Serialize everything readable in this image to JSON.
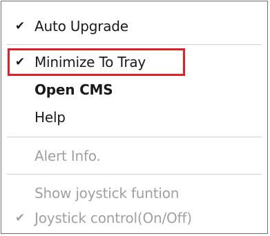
{
  "menu": {
    "items": [
      {
        "label": "Auto Upgrade",
        "checked": true,
        "check_glyph": "✔",
        "enabled": true
      },
      {
        "label": "Minimize To Tray",
        "checked": true,
        "check_glyph": "✔",
        "enabled": true,
        "highlighted": true
      },
      {
        "label": "Open CMS",
        "checked": false,
        "enabled": true,
        "bold": true
      },
      {
        "label": "Help",
        "checked": false,
        "enabled": true
      },
      {
        "label": "Alert Info.",
        "checked": false,
        "enabled": false
      },
      {
        "label": "Show joystick funtion",
        "checked": false,
        "enabled": false
      },
      {
        "label": "Joystick control(On/Off)",
        "checked": true,
        "check_glyph": "✔",
        "enabled": false
      }
    ]
  },
  "colors": {
    "highlight_border": "#e31e24",
    "disabled_text": "#a0a0a0",
    "text": "#1a1a1a"
  }
}
